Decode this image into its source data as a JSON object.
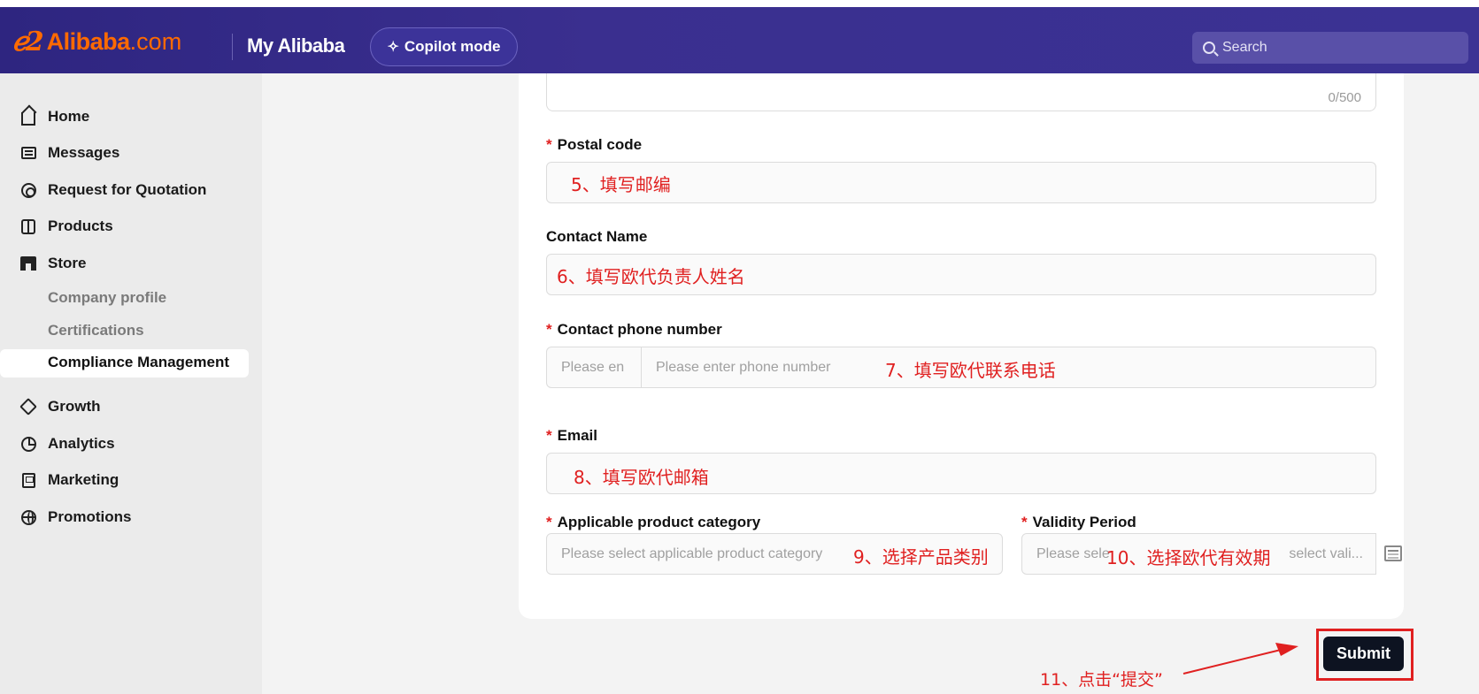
{
  "header": {
    "logo_mark": "ℯ2",
    "logo_brand": "Alibaba",
    "logo_tld": ".com",
    "section_title": "My Alibaba",
    "copilot_label": "Copilot mode",
    "search_placeholder": "Search"
  },
  "sidebar": {
    "items": [
      {
        "label": "Home",
        "icon": "home-icon"
      },
      {
        "label": "Messages",
        "icon": "message-icon"
      },
      {
        "label": "Request for Quotation",
        "icon": "target-icon"
      },
      {
        "label": "Products",
        "icon": "box-icon"
      },
      {
        "label": "Store",
        "icon": "store-icon"
      },
      {
        "label": "Growth",
        "icon": "diamond-icon"
      },
      {
        "label": "Analytics",
        "icon": "pie-chart-icon"
      },
      {
        "label": "Marketing",
        "icon": "ad-icon"
      },
      {
        "label": "Promotions",
        "icon": "globe-icon"
      }
    ],
    "store_sub": [
      {
        "label": "Company profile"
      },
      {
        "label": "Certifications"
      },
      {
        "label": "Compliance Management",
        "active": true
      }
    ]
  },
  "form": {
    "address_counter": "0/500",
    "postal_code": {
      "label": "Postal code",
      "required": true,
      "note": "5、填写邮编"
    },
    "contact_name": {
      "label": "Contact Name",
      "required": false,
      "note": "6、填写欧代负责人姓名"
    },
    "contact_phone": {
      "label": "Contact phone number",
      "required": true,
      "code_placeholder": "Please en",
      "placeholder": "Please enter phone number",
      "note": "7、填写欧代联系电话"
    },
    "email": {
      "label": "Email",
      "required": true,
      "note": "8、填写欧代邮箱"
    },
    "category": {
      "label": "Applicable product category",
      "required": true,
      "placeholder": "Please select applicable product category",
      "note": "9、选择产品类别"
    },
    "validity": {
      "label": "Validity Period",
      "required": true,
      "placeholder_start": "Please sele",
      "placeholder_end": "select vali...",
      "note": "10、选择欧代有效期"
    },
    "required_mark": "*"
  },
  "submit": {
    "label": "Submit",
    "note": "11、点击“提交”"
  }
}
